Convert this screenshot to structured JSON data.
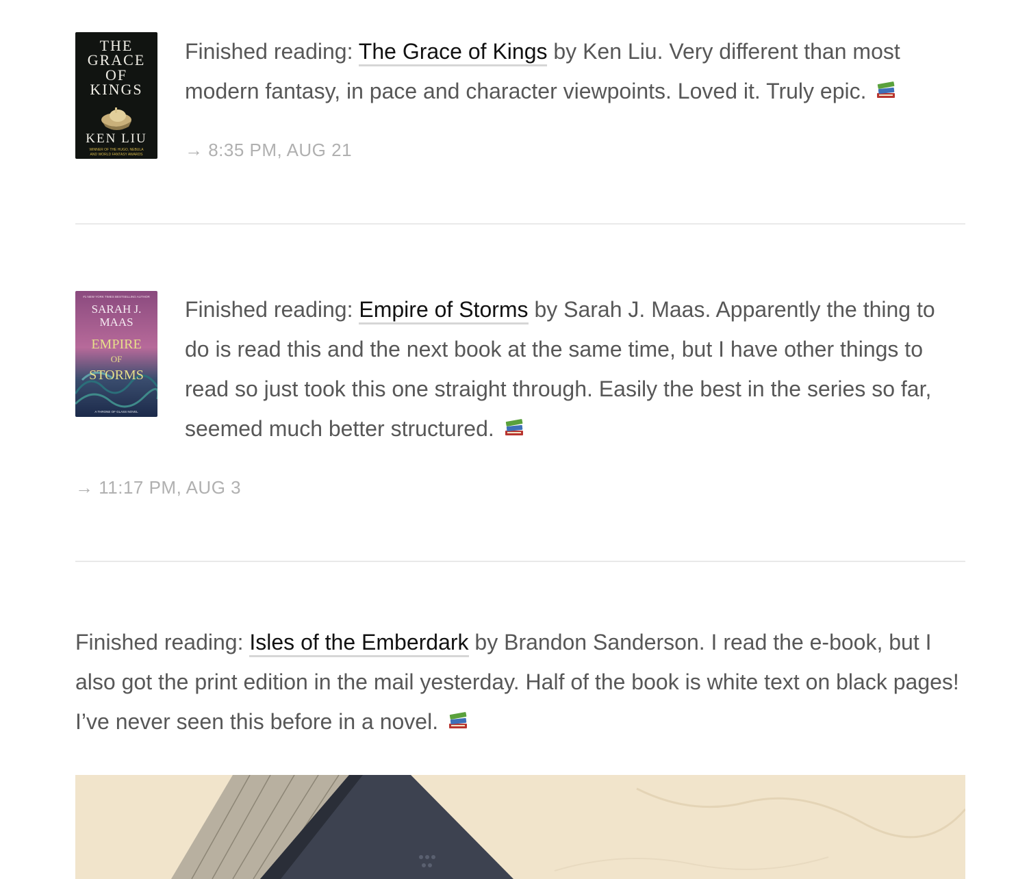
{
  "posts": [
    {
      "prefix": "Finished reading:",
      "book_title": "The Grace of Kings",
      "body": " by Ken Liu. Very different than most modern fantasy, in pace and character viewpoints. Loved it. Truly epic.",
      "emoji_icon": "books-icon",
      "timestamp": "→ 8:35 PM, AUG 21",
      "cover": {
        "title_lines": [
          "THE",
          "GRACE",
          "OF",
          "KINGS"
        ],
        "author": "KEN LIU",
        "tagline_lines": [
          "WINNER OF THE HUGO, NEBULA",
          "AND WORLD FANTASY AWARDS"
        ],
        "background": "#111411",
        "text_color": "#f0eee6"
      }
    },
    {
      "prefix": "Finished reading:",
      "book_title": "Empire of Storms",
      "body": " by Sarah J. Maas. Apparently the thing to do is read this and the next book at the same time, but I have other things to read so just took this one straight through. Easily the best in the series so far, seemed much better structured.",
      "emoji_icon": "books-icon",
      "timestamp": "→ 11:17 PM, AUG 3",
      "cover": {
        "banner": "#1 NEW YORK TIMES BESTSELLING AUTHOR",
        "author_lines": [
          "SARAH J.",
          "MAAS"
        ],
        "title_lines": [
          "EMPIRE",
          "OF",
          "STORMS"
        ],
        "series": "A THRONE OF GLASS NOVEL",
        "top_color": "#8a4a7e",
        "bottom_color": "#1c2a4a",
        "title_color": "#e7df8a"
      }
    },
    {
      "prefix": "Finished reading:",
      "book_title": "Isles of the Emberdark",
      "body": " by Brandon Sanderson. I read the e-book, but I also got the print edition in the mail yesterday. Half of the book is white text on black pages! I’ve never seen this before in a novel.",
      "emoji_icon": "books-icon",
      "photo_description_icon": "book-photo"
    }
  ],
  "colors": {
    "text": "#575757",
    "link": "#111111",
    "link_underline": "#d6d6d6",
    "meta": "#b0b0b0",
    "divider": "#e9e9e9"
  }
}
